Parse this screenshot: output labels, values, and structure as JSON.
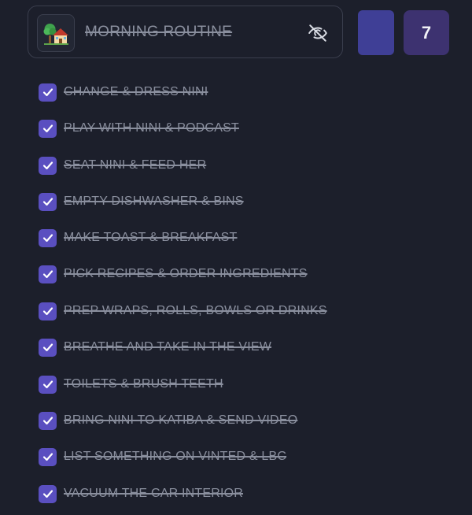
{
  "header": {
    "emoji": "🏡",
    "title": "MORNING ROUTINE",
    "visibility_icon": "eye-off-icon",
    "swatch_color": "#3f3f96",
    "count": "7"
  },
  "tasks": [
    {
      "label": "CHANGE & DRESS NINI",
      "checked": true
    },
    {
      "label": "PLAY WITH NINI & PODCAST",
      "checked": true
    },
    {
      "label": "SEAT NINI & FEED HER",
      "checked": true
    },
    {
      "label": "EMPTY DISHWASHER & BINS",
      "checked": true
    },
    {
      "label": "MAKE TOAST & BREAKFAST",
      "checked": true
    },
    {
      "label": "PICK RECIPES & ORDER INGREDIENTS",
      "checked": true
    },
    {
      "label": "PREP WRAPS, ROLLS, BOWLS OR DRINKS",
      "checked": true
    },
    {
      "label": "BREATHE AND TAKE IN THE VIEW",
      "checked": true
    },
    {
      "label": "TOILETS & BRUSH TEETH",
      "checked": true
    },
    {
      "label": "BRING NINI TO KATIBA & SEND VIDEO",
      "checked": true
    },
    {
      "label": "LIST SOMETHING ON VINTED & LBC",
      "checked": true
    },
    {
      "label": "VACUUM THE CAR INTERIOR",
      "checked": true
    }
  ],
  "colors": {
    "background": "#1c1f2b",
    "checkbox": "#5a4fc0",
    "badge": "#3d3270",
    "muted_text": "#8a8f9e"
  }
}
